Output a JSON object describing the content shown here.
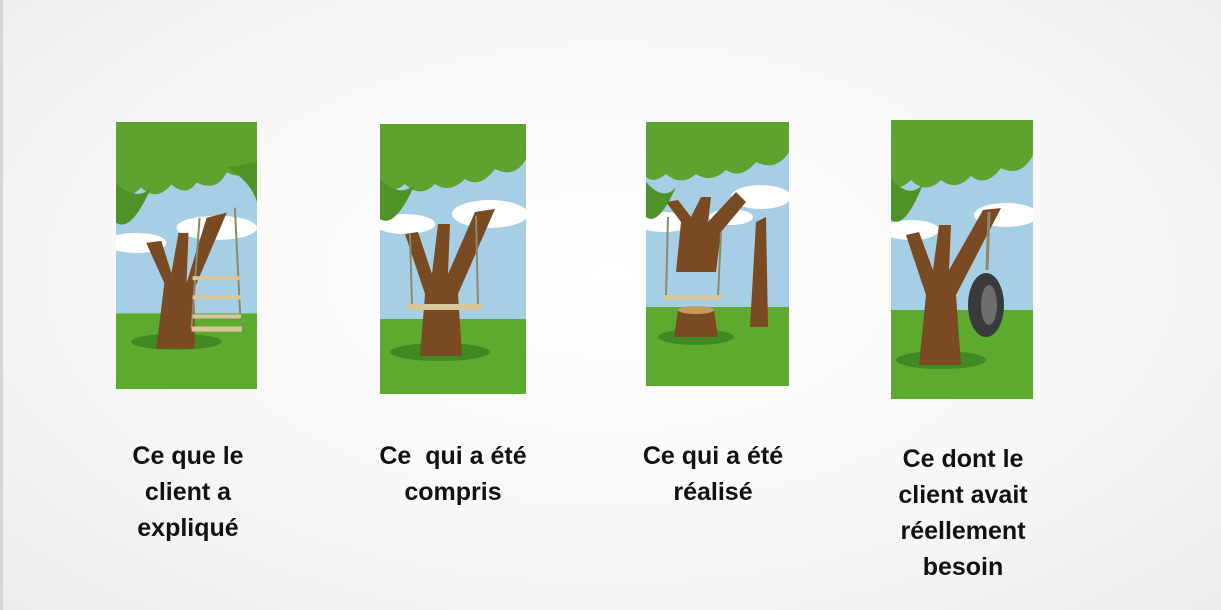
{
  "colors": {
    "sky": "#a6cfe6",
    "cloud": "#ffffff",
    "foliage": "#5fa32e",
    "foliage_dark": "#3e7a1e",
    "grass": "#5cab2e",
    "trunk": "#7a4a22",
    "rope": "#8a8a6a",
    "seat": "#d9c69a",
    "tire": "#3a3a3a",
    "caption_text": "#111111"
  },
  "panels": [
    {
      "illustration": "tree-with-ladder-swing",
      "caption_lines": [
        "Ce que le",
        "client a",
        "expliqué"
      ]
    },
    {
      "illustration": "tree-with-swing-around-trunk",
      "caption_lines": [
        "Ce  qui a été",
        "compris"
      ]
    },
    {
      "illustration": "tree-cut-with-swing",
      "caption_lines": [
        "Ce qui a été",
        "réalisé"
      ]
    },
    {
      "illustration": "tree-with-tire-swing",
      "caption_lines": [
        "Ce dont le",
        "client avait",
        "réellement",
        "besoin"
      ]
    }
  ]
}
